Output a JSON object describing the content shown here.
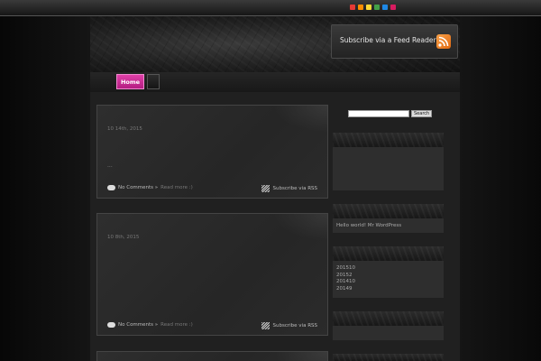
{
  "topbar": {
    "dot_colors": [
      "#e53935",
      "#fb8c00",
      "#fdd835",
      "#43a047",
      "#1e88e5",
      "#d81b60"
    ]
  },
  "header": {
    "subscribe_label": "Subscribe via a Feed Reader"
  },
  "nav": {
    "items": [
      {
        "label": "Home",
        "active": true
      },
      {
        "label": "",
        "active": false
      }
    ]
  },
  "posts": [
    {
      "date": "10 14th, 2015",
      "excerpt": "...",
      "comments_label": "No Comments »",
      "readmore_label": "Read more :)",
      "rss_label": "Subscribe via RSS"
    },
    {
      "date": "10 8th, 2015",
      "excerpt": "",
      "comments_label": "No Comments »",
      "readmore_label": "Read more :)",
      "rss_label": "Subscribe via RSS"
    }
  ],
  "sidebar": {
    "search_button_label": "Search",
    "search_value": "",
    "recent_posts": "Hello world!   Mr WordPress",
    "archives": [
      "201510",
      "20152",
      "201410",
      "20149"
    ]
  },
  "colors": {
    "accent": "#c42a92",
    "background": "#0c0c0c",
    "panel": "#2e2e2e"
  }
}
